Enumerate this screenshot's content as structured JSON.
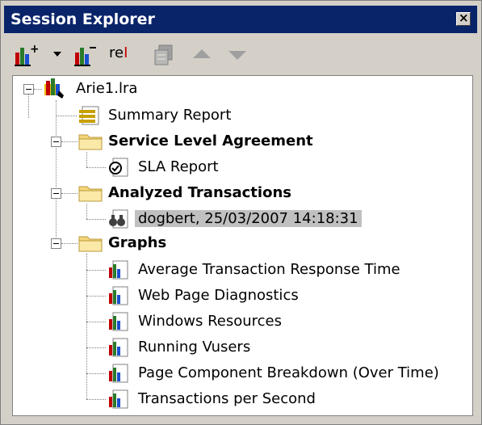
{
  "window": {
    "title": "Session Explorer"
  },
  "toolbar": {
    "items": [
      {
        "name": "add-graph-icon",
        "label": ""
      },
      {
        "name": "dropdown-arrow-icon",
        "label": ""
      },
      {
        "name": "remove-graph-icon",
        "label": ""
      },
      {
        "name": "rename-icon",
        "label": "re"
      },
      {
        "name": "copy-icon",
        "label": ""
      },
      {
        "name": "move-up-icon",
        "label": ""
      },
      {
        "name": "move-down-icon",
        "label": ""
      }
    ]
  },
  "tree": {
    "root": {
      "label": "Arie1.lra"
    },
    "summary": {
      "label": "Summary Report"
    },
    "sla_folder": {
      "label": "Service Level Agreement"
    },
    "sla_report": {
      "label": "SLA Report"
    },
    "analyzed_folder": {
      "label": "Analyzed Transactions"
    },
    "analyzed_item": {
      "label": "dogbert, 25/03/2007 14:18:31"
    },
    "graphs_folder": {
      "label": "Graphs"
    },
    "graphs": [
      {
        "label": "Average Transaction Response Time"
      },
      {
        "label": "Web Page Diagnostics"
      },
      {
        "label": "Windows Resources"
      },
      {
        "label": "Running Vusers"
      },
      {
        "label": "Page Component Breakdown (Over Time)"
      },
      {
        "label": "Transactions per Second"
      }
    ]
  },
  "colors": {
    "titlebar": "#0a246a",
    "panel": "#d4d0c8",
    "selection": "#c0c0c0",
    "folder": "#f5d77a"
  }
}
